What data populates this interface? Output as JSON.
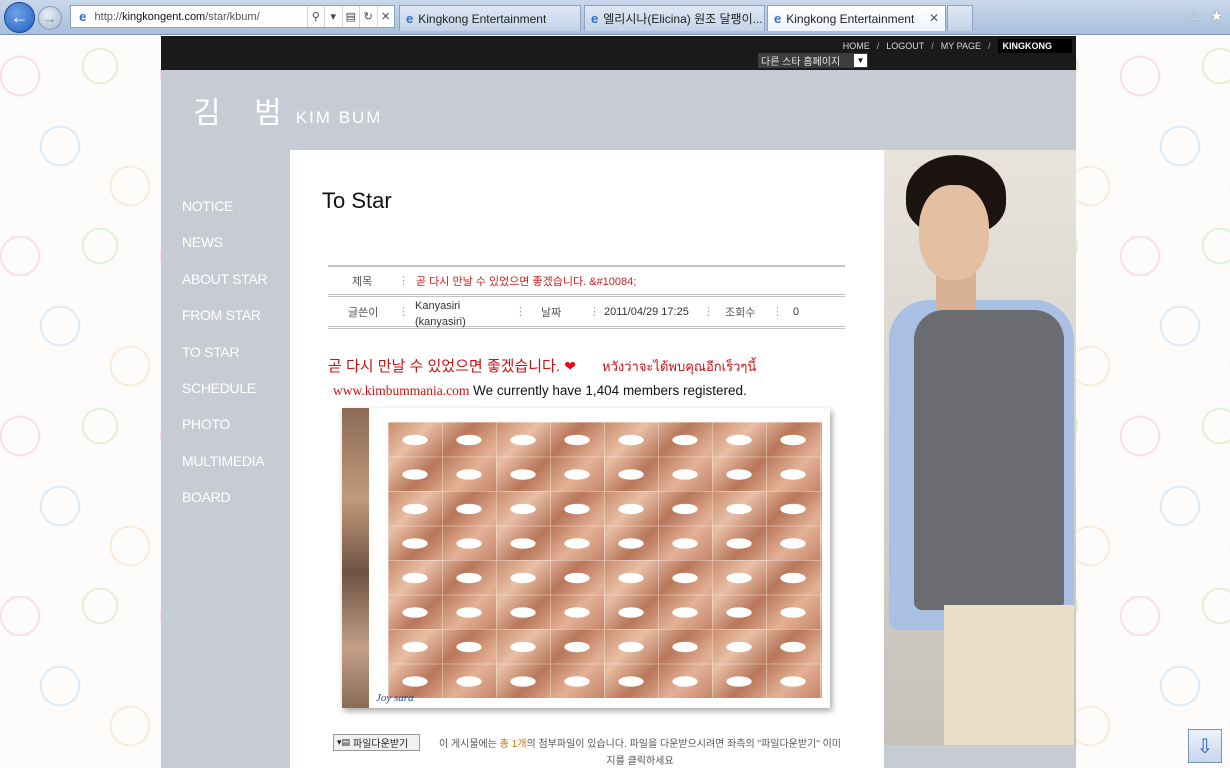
{
  "browser": {
    "url_prefix": "http://",
    "url_domain": "kingkongent.com",
    "url_path": "/star/kbum/",
    "tabs": [
      {
        "label": "Kingkong Entertainment"
      },
      {
        "label": "엘리시나(Elicina) 원조 달팽이..."
      },
      {
        "label": "Kingkong Entertainment"
      }
    ],
    "icons": {
      "back": "back-arrow-icon",
      "forward": "forward-arrow-icon",
      "home": "home-icon",
      "favorites": "star-icon"
    }
  },
  "topnav": {
    "items": [
      "HOME",
      "LOGOUT",
      "MY PAGE",
      "KINGKONG"
    ],
    "separator": "/",
    "star_select": "다른 스타 홈페이지"
  },
  "site": {
    "name_ko": "김 범",
    "name_en": "KIM BUM"
  },
  "sidenav": [
    "NOTICE",
    "NEWS",
    "ABOUT STAR",
    "FROM STAR",
    "TO STAR",
    "SCHEDULE",
    "PHOTO",
    "MULTIMEDIA",
    "BOARD"
  ],
  "content": {
    "title": "To Star",
    "meta": {
      "subject_label": "제목",
      "subject": "곧 다시 만날 수 있었으면 좋겠습니다. &#10084;",
      "author_label": "글쓴이",
      "author_line1": "Kanyasiri",
      "author_line2": "(kanyasiri)",
      "date_label": "날짜",
      "date": "2011/04/29 17:25",
      "views_label": "조회수",
      "views": "0"
    },
    "body_title": "곧 다시 만날 수 있었으면 좋겠습니다.",
    "body_heart": "❤",
    "body_thai": "หวังว่าจะได้พบคุณอีกเร็วๆนี้",
    "body_site": "www.kimbummania.com",
    "body_members": " We currently have 1,404 members registered.",
    "signature": "Joy sara",
    "attach_button": "파일다운받기",
    "attach_note_1": "이 게시물에는 ",
    "attach_note_count": "총 1개",
    "attach_note_2": "의 첨부파일이 있습니다. 파일을 다운받으시려면 좌측의 \"파일다운받기\" 이미지를 클릭하세요"
  },
  "colors": {
    "accent": "#cc1111",
    "sidebar": "#c7cbd3",
    "topbar": "#1a1a1a"
  }
}
